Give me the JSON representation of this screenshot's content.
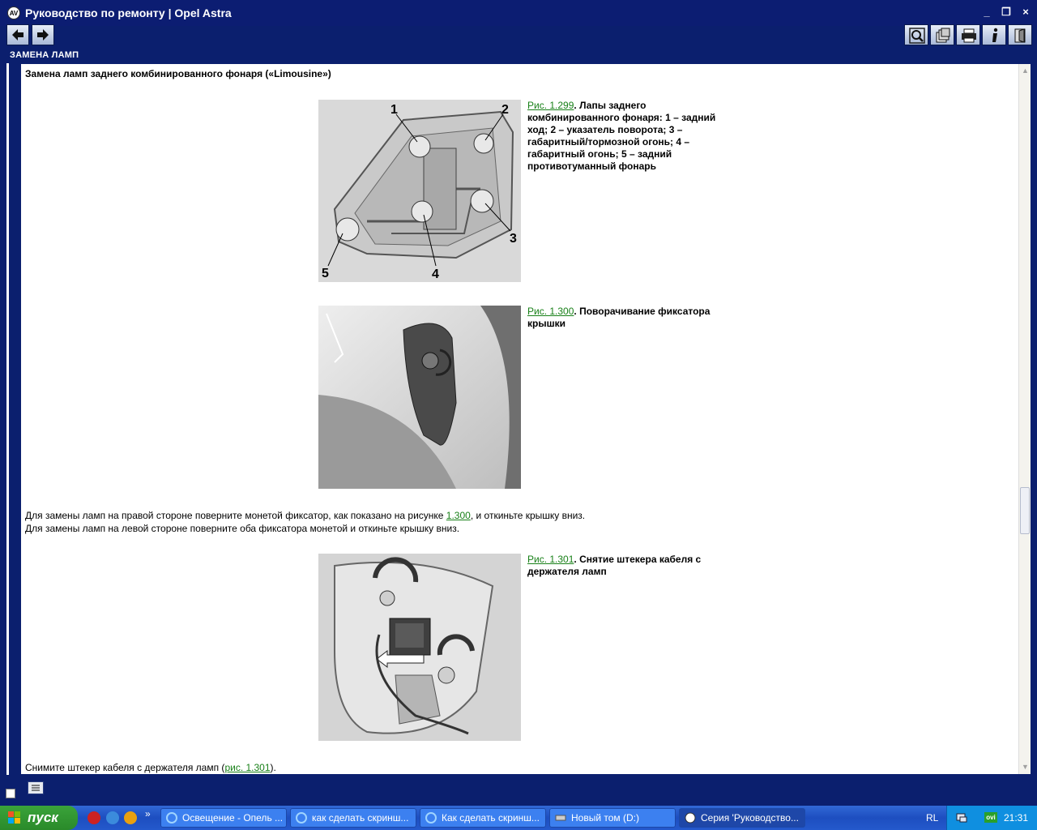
{
  "window": {
    "icon": "app-logo-icon",
    "title": "Руководство по ремонту  | Opel Astra",
    "controls": [
      "minimize",
      "restore",
      "close"
    ]
  },
  "toolbar": {
    "back_icon": "arrow-left-icon",
    "forward_icon": "arrow-right-icon",
    "tools": [
      "search-icon",
      "bookmarks-icon",
      "print-icon",
      "info-icon",
      "exit-icon"
    ]
  },
  "section": {
    "label": "ЗАМЕНА ЛАМП"
  },
  "content": {
    "heading": "Замена ламп заднего комбинированного фонаря («Limousine»)",
    "figures": [
      {
        "link": "Рис. 1.299",
        "caption": ". Лапы заднего комбинированного фонаря: 1 – задний ход; 2 – указатель поворота; 3 – габаритный/тормозной огонь; 4 – габаритный огонь; 5 – задний противотуманный фонарь",
        "callouts": [
          "1",
          "2",
          "3",
          "4",
          "5"
        ]
      },
      {
        "link": "Рис. 1.300",
        "caption": ". Поворачивание фиксатора крышки"
      },
      {
        "link": "Рис. 1.301",
        "caption": ". Снятие штекера кабеля с держателя ламп"
      }
    ],
    "para1_before": "Для замены ламп на правой стороне поверните монетой фиксатор, как показано на рисунке ",
    "para1_link": "1.300",
    "para1_after": ", и откиньте крышку вниз.",
    "para2": "Для замены ламп на левой стороне поверните оба фиксатора монетой и откиньте крышку вниз.",
    "para3_before": "Снимите штекер кабеля с держателя ламп (",
    "para3_link": "рис. 1.301",
    "para3_after": ")."
  },
  "taskbar": {
    "start_label": "пуск",
    "overflow": "»",
    "tasks": [
      {
        "label": "Освещение - Опель ...",
        "icon": "ie-icon"
      },
      {
        "label": "как сделать скринш...",
        "icon": "ie-icon"
      },
      {
        "label": "Как сделать скринш...",
        "icon": "ie-icon"
      },
      {
        "label": "Новый том (D:)",
        "icon": "drive-icon"
      },
      {
        "label": "Серия 'Руководство...",
        "icon": "app-logo-icon"
      }
    ],
    "lang": "RL",
    "tray_badge": "ovi",
    "clock": "21:31"
  },
  "colors": {
    "frame": "#0b1f6e",
    "link": "#188018",
    "taskbar": "#245edb",
    "start": "#34a534"
  }
}
